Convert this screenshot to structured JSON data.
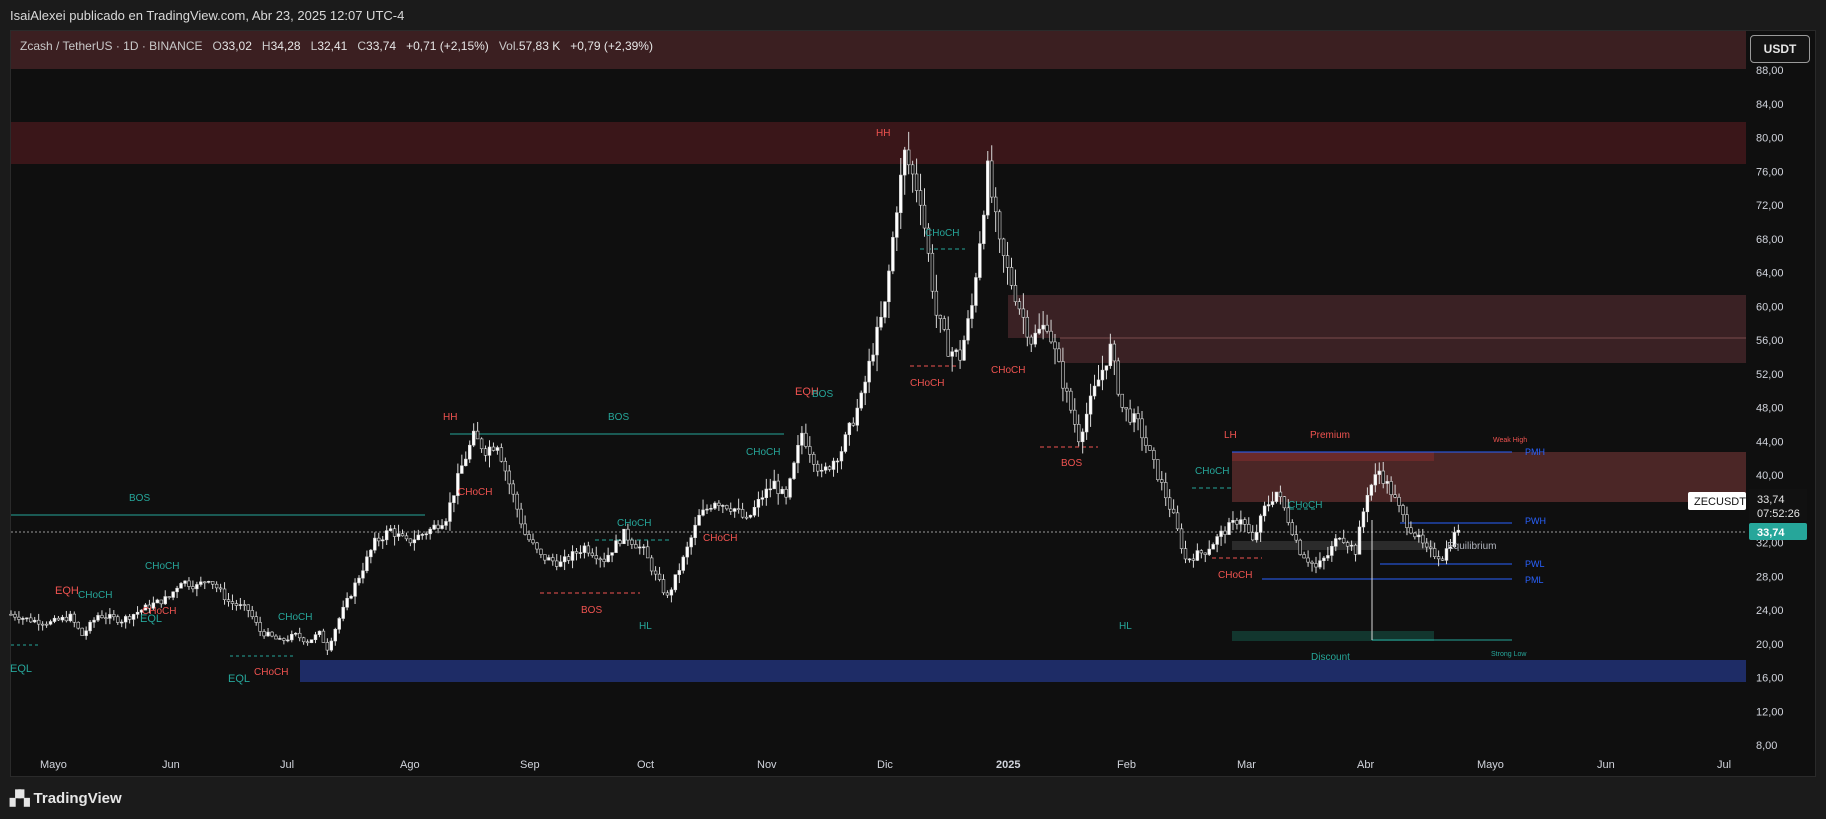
{
  "header": {
    "published_line": "IsaiAlexei publicado en TradingView.com, Abr 23, 2025 12:07 UTC-4"
  },
  "legend": {
    "symbol": "Zcash / TetherUS · 1D · BINANCE",
    "open_label": "O",
    "open": "33,02",
    "high_label": "H",
    "high": "34,28",
    "low_label": "L",
    "low": "32,41",
    "close_label": "C",
    "close": "33,74",
    "change": "+0,71 (+2,15%)",
    "vol_label": "Vol.",
    "vol": "57,83 K",
    "vol_change": "+0,79 (+2,39%)"
  },
  "currency_button": "USDT",
  "price_tag": {
    "symbol": "ZECUSDT",
    "price": "33,74",
    "countdown": "07:52:26",
    "last_price": "33,74"
  },
  "footer": {
    "brand": "TradingView"
  },
  "colors": {
    "bull": "#26a69a",
    "bear": "#ef5350",
    "supply_zone": "#3d1d1f",
    "demand_zone": "#1e2c66",
    "premium_zone": "#4b2626",
    "discount_zone": "#12362e",
    "level_blue": "#2962ff"
  },
  "chart_data": {
    "type": "candlestick",
    "y_axis": {
      "min": 8,
      "max": 90,
      "ticks": [
        "88,00",
        "84,00",
        "80,00",
        "76,00",
        "72,00",
        "68,00",
        "64,00",
        "60,00",
        "56,00",
        "52,00",
        "48,00",
        "44,00",
        "40,00",
        "36,00",
        "32,00",
        "28,00",
        "24,00",
        "20,00",
        "16,00",
        "12,00",
        "8,00"
      ]
    },
    "x_axis_labels": [
      "Mayo",
      "Jun",
      "Jul",
      "Ago",
      "Sep",
      "Oct",
      "Nov",
      "Dic",
      "2025",
      "Feb",
      "Mar",
      "Abr",
      "Mayo",
      "Jun",
      "Jul"
    ],
    "price_path": [
      [
        0,
        23.5
      ],
      [
        5,
        22.8
      ],
      [
        10,
        22.5
      ],
      [
        15,
        23.2
      ],
      [
        18,
        21
      ],
      [
        22,
        23.4
      ],
      [
        28,
        22.8
      ],
      [
        35,
        24.5
      ],
      [
        40,
        25.5
      ],
      [
        43,
        27.5
      ],
      [
        47,
        26.8
      ],
      [
        50,
        27.8
      ],
      [
        55,
        25
      ],
      [
        60,
        24
      ],
      [
        63,
        21.5
      ],
      [
        68,
        20.3
      ],
      [
        72,
        21
      ],
      [
        75,
        20.3
      ],
      [
        78,
        21.2
      ],
      [
        80,
        19.5
      ],
      [
        83,
        23
      ],
      [
        87,
        27
      ],
      [
        92,
        32
      ],
      [
        96,
        33.5
      ],
      [
        100,
        32
      ],
      [
        106,
        33.5
      ],
      [
        110,
        35
      ],
      [
        114,
        41
      ],
      [
        117,
        44.5
      ],
      [
        120,
        43
      ],
      [
        123,
        43.8
      ],
      [
        126,
        39
      ],
      [
        130,
        33
      ],
      [
        134,
        30.3
      ],
      [
        139,
        29.5
      ],
      [
        145,
        31.5
      ],
      [
        150,
        30
      ],
      [
        155,
        33
      ],
      [
        160,
        31
      ],
      [
        163,
        28
      ],
      [
        166,
        25.5
      ],
      [
        170,
        30
      ],
      [
        174,
        35
      ],
      [
        178,
        37
      ],
      [
        183,
        36
      ],
      [
        186,
        34.5
      ],
      [
        190,
        37.5
      ],
      [
        193,
        39
      ],
      [
        196,
        37
      ],
      [
        200,
        45
      ],
      [
        205,
        40
      ],
      [
        210,
        43
      ],
      [
        215,
        49
      ],
      [
        218,
        55
      ],
      [
        221,
        60
      ],
      [
        224,
        72
      ],
      [
        226,
        78
      ],
      [
        230,
        73
      ],
      [
        234,
        59
      ],
      [
        237,
        55
      ],
      [
        240,
        54
      ],
      [
        243,
        60
      ],
      [
        247,
        76
      ],
      [
        250,
        67
      ],
      [
        255,
        60
      ],
      [
        258,
        56
      ],
      [
        262,
        58
      ],
      [
        266,
        51
      ],
      [
        270,
        44.5
      ],
      [
        274,
        50
      ],
      [
        278,
        55
      ],
      [
        281,
        48
      ],
      [
        285,
        46
      ],
      [
        290,
        40
      ],
      [
        294,
        35
      ],
      [
        297,
        30
      ],
      [
        302,
        31
      ],
      [
        306,
        33
      ],
      [
        311,
        35
      ],
      [
        314,
        32
      ],
      [
        317,
        36
      ],
      [
        320,
        38
      ],
      [
        322,
        36
      ],
      [
        326,
        31
      ],
      [
        330,
        29
      ],
      [
        333,
        30.5
      ],
      [
        336,
        33
      ],
      [
        340,
        31
      ],
      [
        343,
        38
      ],
      [
        346,
        40.5
      ],
      [
        349,
        38
      ],
      [
        352,
        35
      ],
      [
        355,
        33
      ],
      [
        358,
        31
      ],
      [
        362,
        30.3
      ],
      [
        366,
        33.74
      ]
    ],
    "annotations": [
      {
        "text": "HH",
        "color": "#ef5350"
      },
      {
        "text": "EQH",
        "color": "#ef5350"
      },
      {
        "text": "BOS",
        "color": "#26a69a"
      },
      {
        "text": "CHoCH",
        "color": "#26a69a"
      },
      {
        "text": "CHoCH",
        "color": "#ef5350"
      },
      {
        "text": "EQL",
        "color": "#26a69a"
      },
      {
        "text": "BOS",
        "color": "#ef5350"
      },
      {
        "text": "HL",
        "color": "#26a69a"
      },
      {
        "text": "LH",
        "color": "#ef5350"
      },
      {
        "text": "Premium",
        "color": "#ef5350"
      },
      {
        "text": "Weak High",
        "color": "#ef5350"
      },
      {
        "text": "PMH",
        "color": "#2962ff"
      },
      {
        "text": "PWH",
        "color": "#2962ff"
      },
      {
        "text": "Equilibrium",
        "color": "#b2b5be"
      },
      {
        "text": "PWL",
        "color": "#2962ff"
      },
      {
        "text": "PML",
        "color": "#2962ff"
      },
      {
        "text": "Discount",
        "color": "#26a69a"
      },
      {
        "text": "Strong Low",
        "color": "#26a69a"
      }
    ]
  }
}
